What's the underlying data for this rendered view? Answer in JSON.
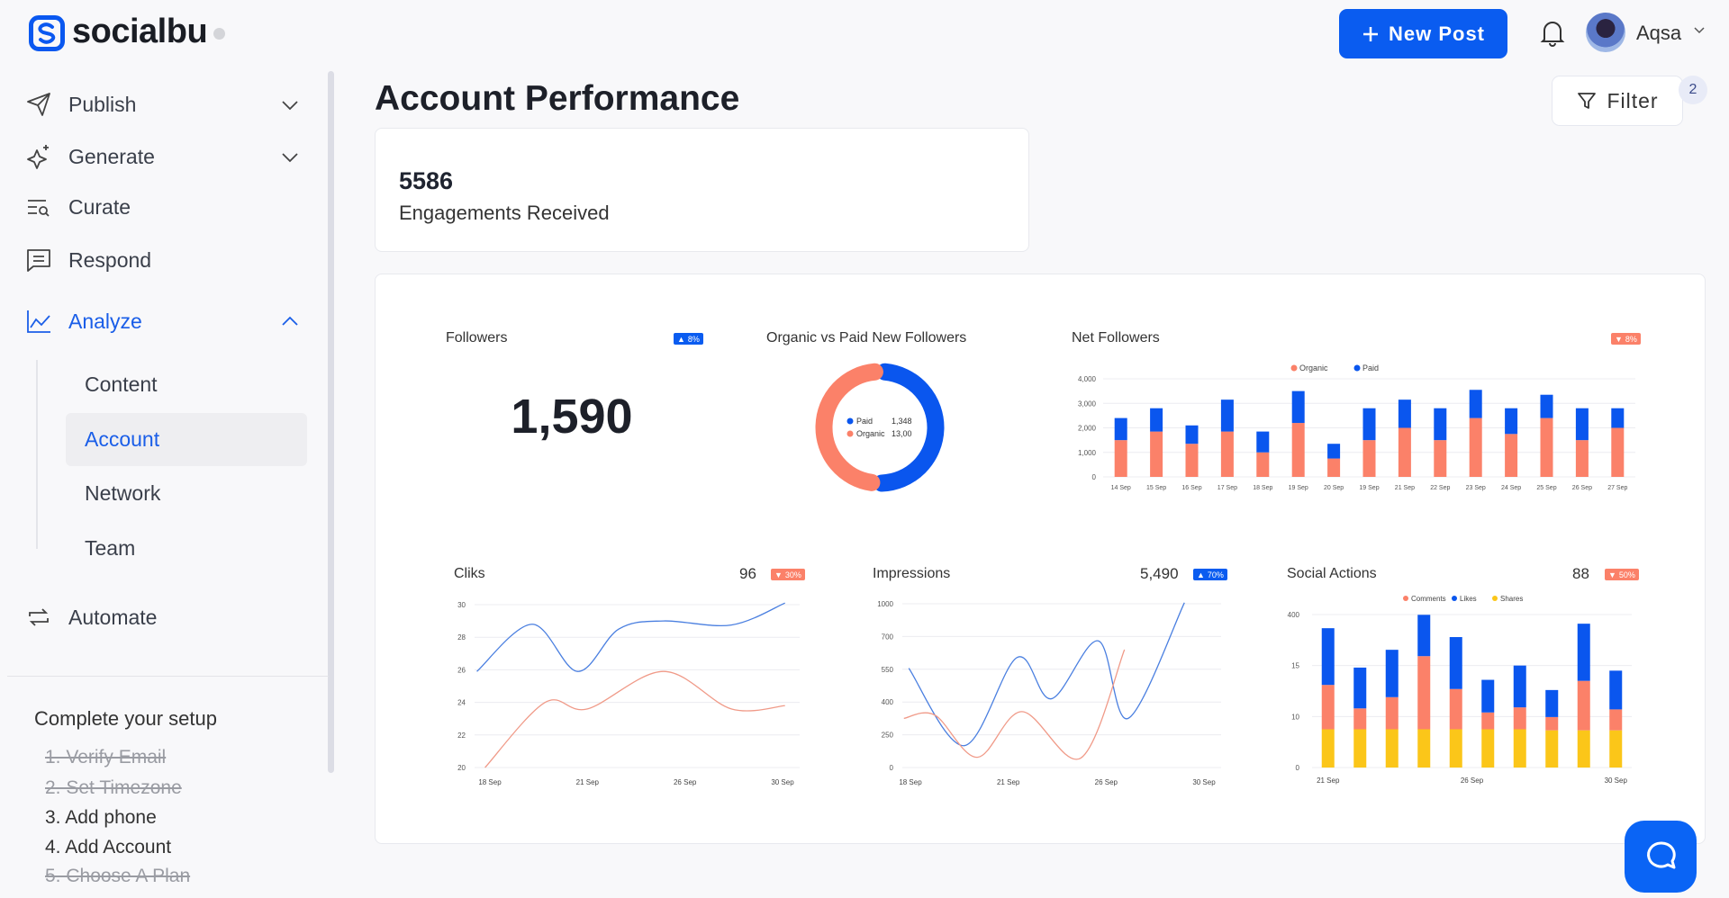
{
  "app": {
    "name": "socialbu",
    "logo_icon": "socialbu-s-logo"
  },
  "header": {
    "new_post": "New Post",
    "user": "Aqsa"
  },
  "sidebar": {
    "items": [
      {
        "label": "Publish",
        "icon": "paper-plane-icon",
        "expandable": true
      },
      {
        "label": "Generate",
        "icon": "sparkle-icon",
        "expandable": true
      },
      {
        "label": "Curate",
        "icon": "list-search-icon"
      },
      {
        "label": "Respond",
        "icon": "message-icon"
      },
      {
        "label": "Analyze",
        "icon": "chart-line-icon",
        "expanded": true,
        "active": true
      },
      {
        "label": "Automate",
        "icon": "repeat-icon"
      }
    ],
    "analyze_sub": [
      "Content",
      "Account",
      "Network",
      "Team"
    ],
    "selected_sub": "Account",
    "setup": {
      "title": "Complete your setup",
      "items": [
        {
          "label": "1. Verify Email",
          "done": true
        },
        {
          "label": "2. Set Timezone",
          "done": true
        },
        {
          "label": "3. Add phone",
          "done": false
        },
        {
          "label": "4. Add Account",
          "done": false
        },
        {
          "label": "5. Choose A Plan",
          "done": true
        }
      ]
    }
  },
  "page": {
    "title": "Account Performance",
    "filter": "Filter",
    "filter_count": "2"
  },
  "engagement": {
    "value": "5586",
    "label": "Engagements Received"
  },
  "colors": {
    "primary": "#0a5cf0",
    "organic": "#fb8169",
    "paid": "#0a56ee",
    "shares": "#fbc619",
    "up": "#0a5cf0",
    "down": "#fb8169"
  },
  "followers": {
    "title": "Followers",
    "value": "1,590",
    "change": "8%",
    "direction": "up"
  },
  "chart_data": [
    {
      "type": "pie",
      "title": "Organic vs Paid New Followers",
      "donut": true,
      "slices": [
        {
          "name": "Paid",
          "label": "1,348",
          "value": 1348
        },
        {
          "name": "Organic",
          "label": "13,00",
          "value": 1300
        }
      ]
    },
    {
      "type": "bar",
      "stacked": true,
      "title": "Net Followers",
      "change": "8%",
      "direction": "down",
      "legend": "top",
      "categories": [
        "14 Sep",
        "15 Sep",
        "16 Sep",
        "17 Sep",
        "18 Sep",
        "19 Sep",
        "20 Sep",
        "19 Sep",
        "21 Sep",
        "22 Sep",
        "23 Sep",
        "24 Sep",
        "25 Sep",
        "26 Sep",
        "27 Sep"
      ],
      "yticks": [
        0,
        1000,
        2000,
        3000,
        4000
      ],
      "ytick_labels": [
        "0",
        "1,000",
        "2,000",
        "3,000",
        "4,000"
      ],
      "ylim": [
        0,
        4000
      ],
      "grid": true,
      "series": [
        {
          "name": "Organic",
          "values": [
            1500,
            1850,
            1350,
            1850,
            1000,
            2200,
            750,
            1500,
            2000,
            1500,
            2400,
            1750,
            2400,
            1500,
            2000
          ]
        },
        {
          "name": "Paid",
          "values": [
            900,
            950,
            750,
            1300,
            850,
            1300,
            600,
            1300,
            1150,
            1300,
            1150,
            1050,
            950,
            1300,
            800
          ]
        }
      ]
    },
    {
      "type": "line",
      "title": "Cliks",
      "value": "96",
      "change": "30%",
      "direction": "down",
      "xticks": [
        18,
        21,
        26,
        30
      ],
      "xtick_labels": [
        "18 Sep",
        "21 Sep",
        "26 Sep",
        "30 Sep"
      ],
      "yticks": [
        20,
        22,
        24,
        26,
        28,
        30
      ],
      "ytick_labels": [
        "20",
        "22",
        "24",
        "26",
        "28",
        "30"
      ],
      "grid": true,
      "series": [
        {
          "color": "#4a7fe0",
          "x": [
            17.6,
            19.3,
            20.7,
            22.6,
            24.9,
            27.9,
            30.1
          ],
          "y": [
            25.9,
            28.8,
            25.9,
            28.5,
            29.0,
            28.75,
            30.1
          ]
        },
        {
          "color": "#f09a88",
          "x": [
            17.85,
            19.7,
            21,
            24.9,
            27.9,
            30.1
          ],
          "y": [
            20,
            24,
            23.6,
            25.9,
            23.6,
            23.8
          ]
        }
      ]
    },
    {
      "type": "line",
      "title": "Impressions",
      "value": "5,490",
      "change": "70%",
      "direction": "up",
      "xticks": [
        18,
        21,
        26,
        30
      ],
      "xtick_labels": [
        "18 Sep",
        "21 Sep",
        "26 Sep",
        "30 Sep"
      ],
      "yticks": [
        0,
        250,
        400,
        550,
        700,
        1000
      ],
      "ytick_labels": [
        "0",
        "250",
        "400",
        "550",
        "700",
        "1000"
      ],
      "grid": true,
      "series": [
        {
          "color": "#4a7fe0",
          "x": [
            17.95,
            19.65,
            21.45,
            23.2,
            25.6,
            26.9,
            29.2
          ],
          "y": [
            555,
            167,
            604,
            415,
            680,
            325,
            1010
          ]
        },
        {
          "color": "#f09a88",
          "x": [
            17.8,
            18.75,
            20.05,
            21.7,
            24.7,
            26.75
          ],
          "y": [
            325,
            340,
            78,
            356,
            72,
            640
          ]
        }
      ]
    },
    {
      "type": "bar",
      "stacked": true,
      "title": "Social Actions",
      "value": "88",
      "change": "50%",
      "direction": "down",
      "legend": "top",
      "yticks": [
        0,
        10,
        15,
        400
      ],
      "ytick_labels": [
        "0",
        "10",
        "15",
        "400"
      ],
      "grid": true,
      "x_tick_labels": [
        {
          "label": "21 Sep",
          "bar_index": 0
        },
        {
          "label": "26 Sep",
          "bar_index": 4.5
        },
        {
          "label": "30 Sep",
          "bar_index": 9
        }
      ],
      "series": [
        {
          "name": "Comments",
          "color": "#fb8169",
          "values": [
            13.1,
            10.8,
            11.9,
            86,
            12.7,
            10.4,
            10.9,
            9.9,
            13.5,
            10.7
          ]
        },
        {
          "name": "Likes",
          "color": "#0a56ee",
          "values": [
            297,
            14.8,
            134,
            398,
            230,
            13.6,
            15,
            12.6,
            331,
            14.5
          ]
        },
        {
          "name": "Shares",
          "color": "#fbc619",
          "values": [
            7.5,
            7.5,
            7.5,
            7.5,
            7.5,
            7.5,
            7.5,
            7.3,
            7.3,
            7.3
          ]
        }
      ],
      "note_order_bottom_to_top": [
        "Shares",
        "Comments",
        "Likes"
      ]
    }
  ]
}
